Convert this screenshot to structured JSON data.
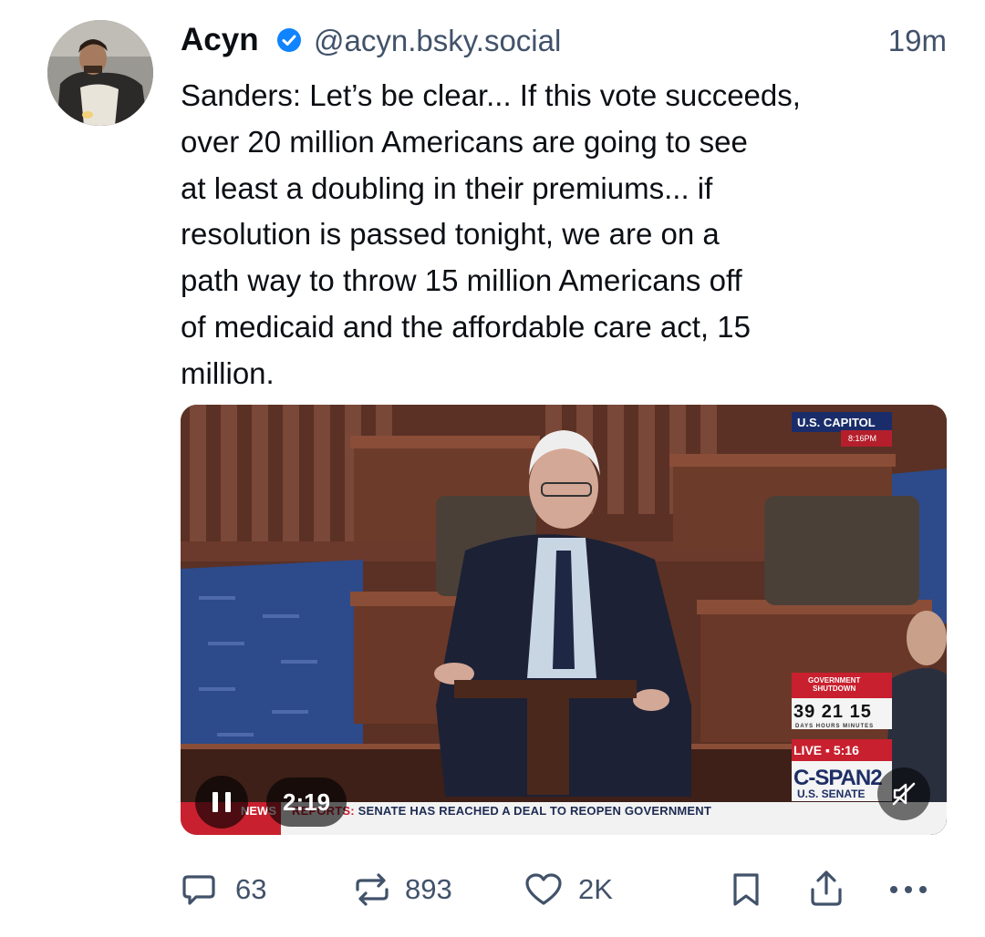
{
  "post": {
    "author_name": "Acyn",
    "handle": "@acyn.bsky.social",
    "timestamp": "19m",
    "verified": true,
    "text": "Sanders: Let’s be clear... If this vote succeeds,\nover 20 million Americans are going to see\nat least a doubling in their premiums... if\nresolution is passed tonight, we are on a\npath way to throw 15 million Americans off\nof medicaid and the affordable care act, 15\nmillion."
  },
  "video": {
    "duration": "2:19",
    "overlay": {
      "capitol_label": "U.S. CAPITOL",
      "capitol_time": "8:16PM",
      "shutdown_label_1": "GOVERNMENT",
      "shutdown_label_2": "SHUTDOWN",
      "counter": "39 21 15",
      "counter_units": "DAYS  HOURS  MINUTES",
      "live_label": "LIVE ▪ 5:16",
      "network": "C-SPAN2",
      "network_sub": "U.S. SENATE",
      "ticker_news": "NEWS",
      "ticker_reports": "REPORTS:",
      "ticker_text": " SENATE HAS REACHED A DEAL TO REOPEN GOVERNMENT"
    }
  },
  "actions": {
    "replies": "63",
    "reposts": "893",
    "likes": "2K"
  },
  "colors": {
    "verified": "#1083fe",
    "secondary_text": "#41526a"
  }
}
